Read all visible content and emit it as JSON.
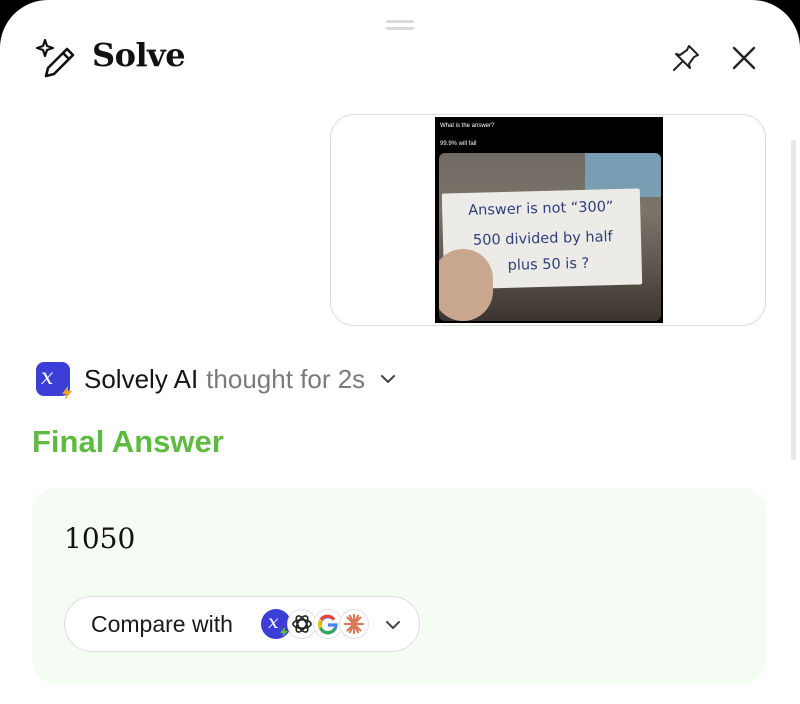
{
  "header": {
    "title": "Solve"
  },
  "attachment": {
    "caption_line1": "What is the answer?",
    "caption_line2": "99.9% will fail",
    "note_lines": [
      "Answer is not “300”",
      "500 divided by half",
      "plus 50 is ?"
    ]
  },
  "assistant": {
    "name": "Solvely AI",
    "status": "thought for 2s"
  },
  "answer": {
    "heading": "Final Answer",
    "value": "1050",
    "compare_label": "Compare with",
    "compare_models": [
      "solvely-icon",
      "chatgpt-icon",
      "google-icon",
      "claude-icon"
    ]
  },
  "colors": {
    "accent_green": "#5dbb3f",
    "brand_blue": "#3b3fd8",
    "answer_bg": "#f5fcf3"
  }
}
